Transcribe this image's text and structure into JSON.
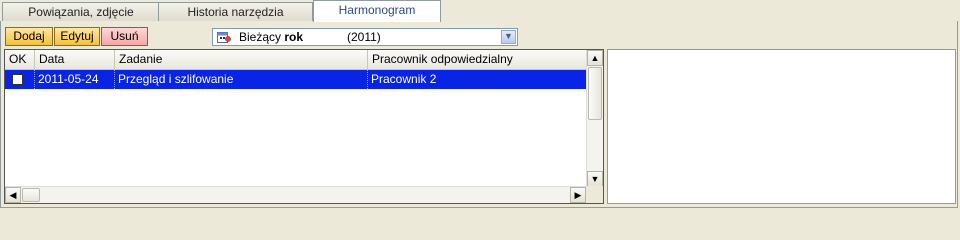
{
  "tabs": [
    {
      "label": "Powiązania, zdjęcie",
      "active": false
    },
    {
      "label": "Historia narzędzia",
      "active": false
    },
    {
      "label": "Harmonogram",
      "active": true
    }
  ],
  "toolbar": {
    "add_label": "Dodaj",
    "edit_label": "Edytuj",
    "delete_label": "Usuń"
  },
  "period_select": {
    "label_prefix": "Bieżący",
    "label_bold": "rok",
    "year": "(2011)",
    "icon": "calendar-icon"
  },
  "grid": {
    "columns": [
      "OK",
      "Data",
      "Zadanie",
      "Pracownik odpowiedzialny"
    ],
    "rows": [
      {
        "ok": false,
        "date": "2011-05-24",
        "task": "Przegląd i szlifowanie",
        "employee": "Pracownik 2",
        "selected": true
      }
    ]
  },
  "colors": {
    "selection": "#0a24e6",
    "accent_button": "#f3c03c",
    "danger_button": "#f5a6a6"
  }
}
